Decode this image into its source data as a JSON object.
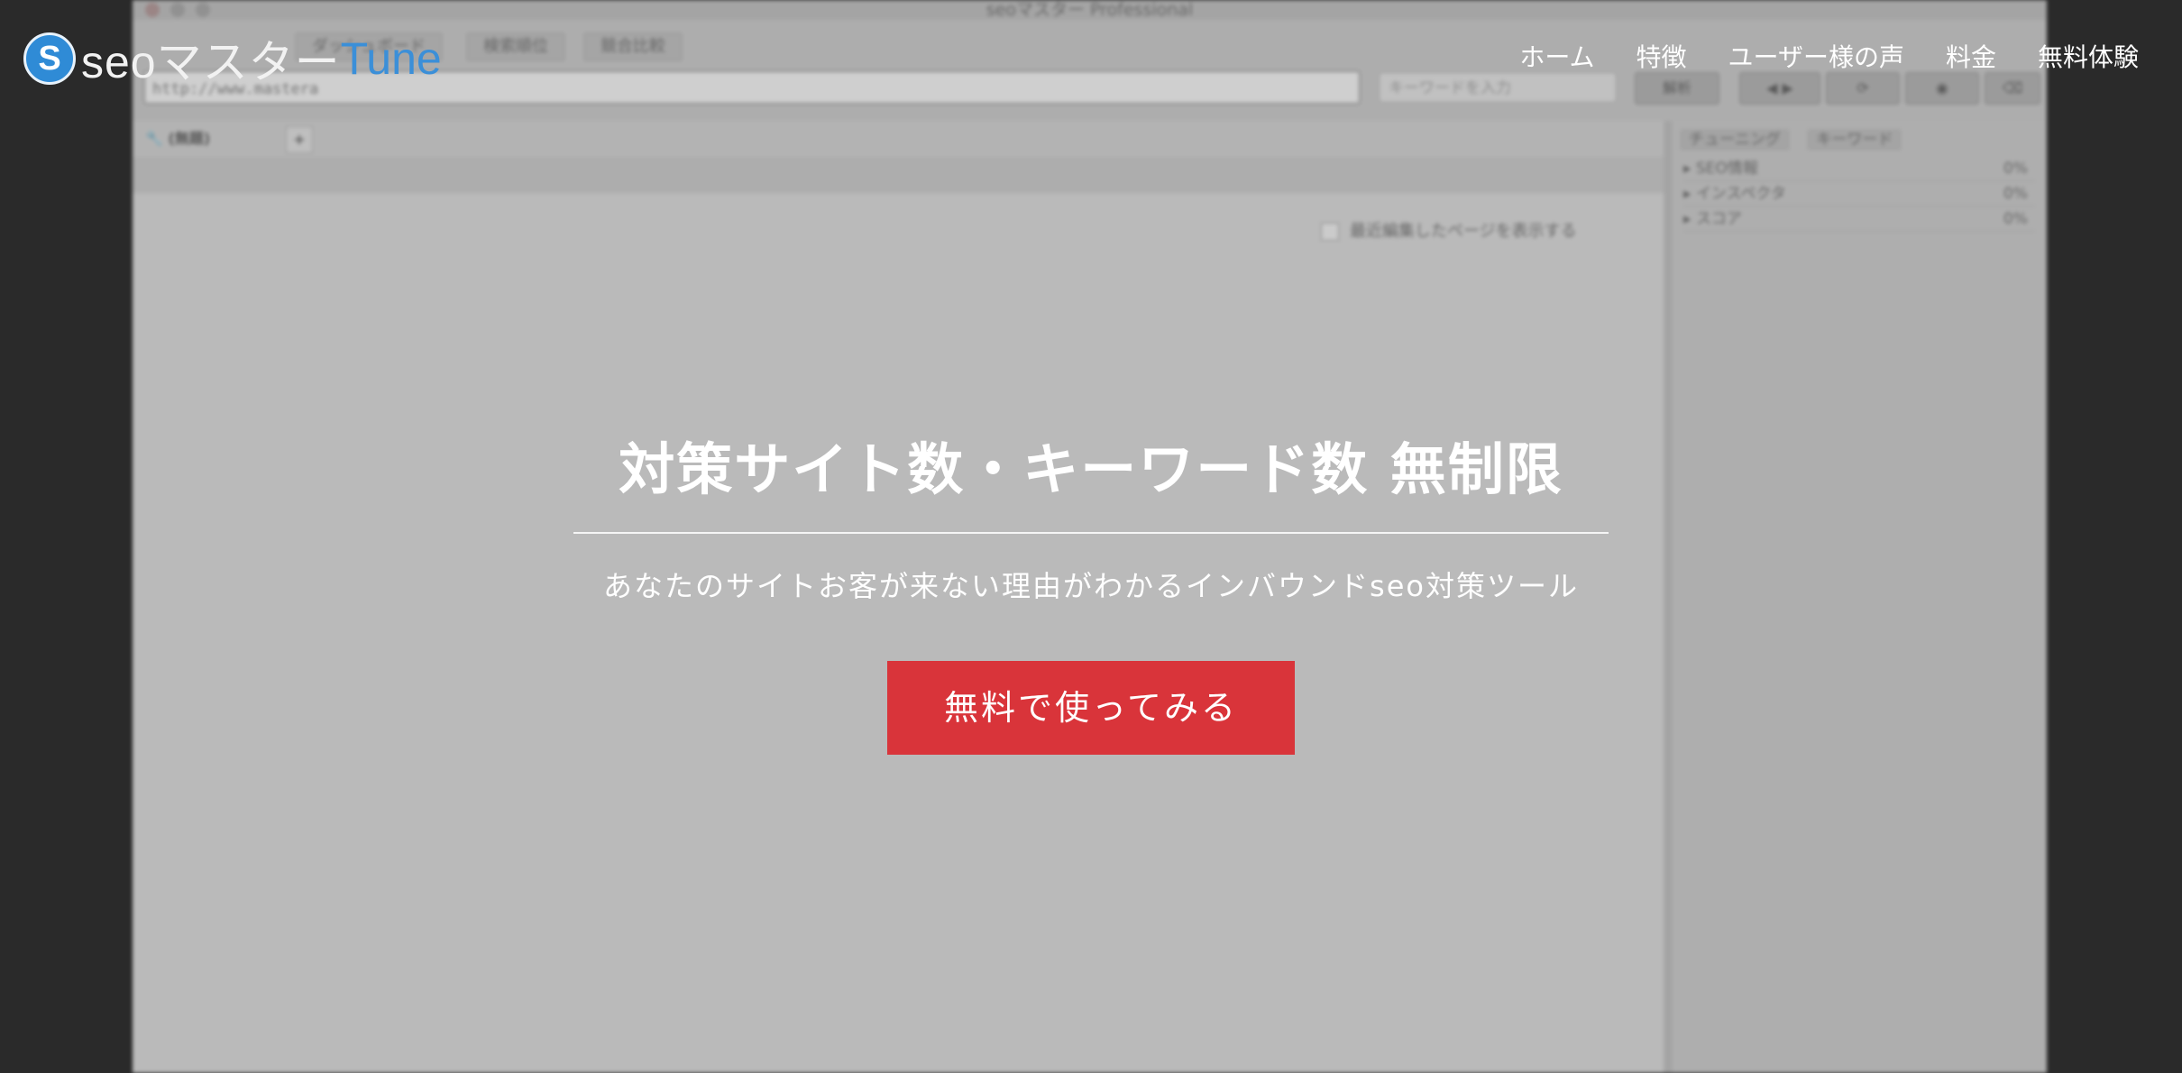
{
  "background_app": {
    "window_title": "seoマスター Professional",
    "tabs": [
      "ダッシュボード",
      "検索順位",
      "競合比較"
    ],
    "url_value": "http://www.mastera",
    "keyword_placeholder": "キーワードを入力",
    "analyze_label": "解析",
    "subtab_label": "(無題)",
    "add_tab_label": "+",
    "recent_checkbox_label": "最近編集したページを表示する",
    "right_tabs": [
      "チューニング",
      "キーワード"
    ],
    "right_rows": [
      {
        "label": "SEO情報",
        "pct": "0%"
      },
      {
        "label": "インスペクタ",
        "pct": "0%"
      },
      {
        "label": "スコア",
        "pct": "0%"
      }
    ]
  },
  "header": {
    "logo_mark": "S",
    "logo_text": "seoマスター",
    "logo_accent": "Tune",
    "nav": [
      "ホーム",
      "特徴",
      "ユーザー様の声",
      "料金",
      "無料体験"
    ]
  },
  "hero": {
    "title": "対策サイト数・キーワード数 無制限",
    "subtitle": "あなたのサイトお客が来ない理由がわかるインバウンドseo対策ツール",
    "cta_label": "無料で使ってみる"
  },
  "colors": {
    "cta": "#d9343a",
    "logo_blue": "#2f8bd6",
    "background": "#060606"
  }
}
